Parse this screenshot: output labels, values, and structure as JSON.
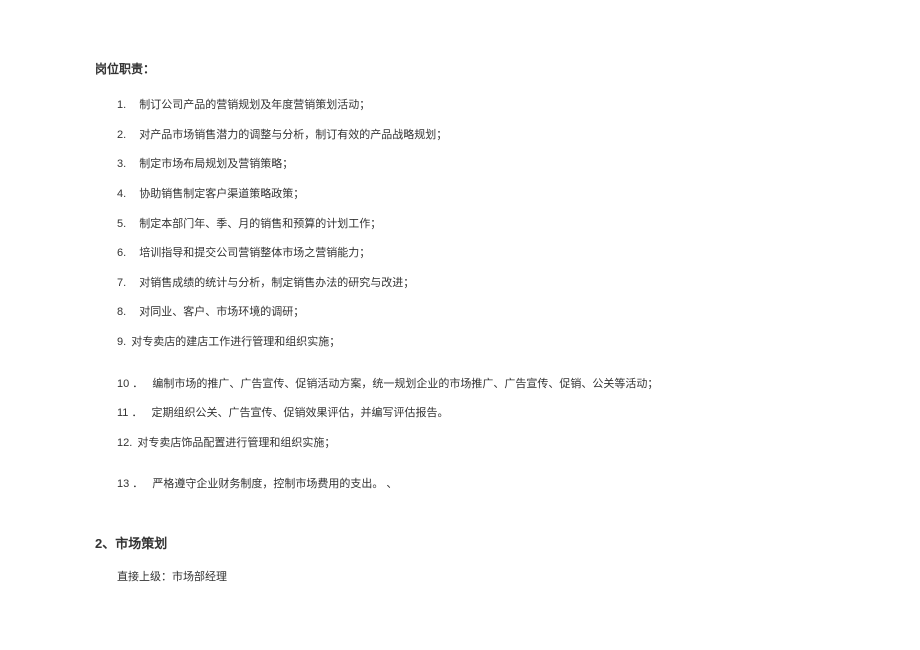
{
  "section_title": "岗位职责：",
  "duties": [
    {
      "num": "1.",
      "text": "制订公司产品的营销规划及年度营销策划活动；"
    },
    {
      "num": "2.",
      "text": "对产品市场销售潜力的调整与分析，制订有效的产品战略规划；"
    },
    {
      "num": "3.",
      "text": "制定市场布局规划及营销策略；"
    },
    {
      "num": "4.",
      "text": "协助销售制定客户渠道策略政策；"
    },
    {
      "num": "5.",
      "text": "制定本部门年、季、月的销售和预算的计划工作；"
    },
    {
      "num": "6.",
      "text": "培训指导和提交公司营销整体市场之营销能力；"
    },
    {
      "num": "7.",
      "text": "对销售成绩的统计与分析，制定销售办法的研究与改进；"
    },
    {
      "num": "8.",
      "text": "对同业、客户、市场环境的调研；"
    },
    {
      "num": "9.",
      "text": "对专卖店的建店工作进行管理和组织实施；"
    },
    {
      "num": "10 ．",
      "text": "编制市场的推广、广告宣传、促销活动方案，统一规划企业的市场推广、广告宣传、促销、公关等活动；"
    },
    {
      "num": "11 ．",
      "text": "定期组织公关、广告宣传、促销效果评估，并编写评估报告。"
    },
    {
      "num": "12.",
      "text": "对专卖店饰品配置进行管理和组织实施；"
    },
    {
      "num": "13 ．",
      "text": "严格遵守企业财务制度，控制市场费用的支出。  、"
    }
  ],
  "subheading": "2、市场策划",
  "subline": "直接上级：市场部经理"
}
